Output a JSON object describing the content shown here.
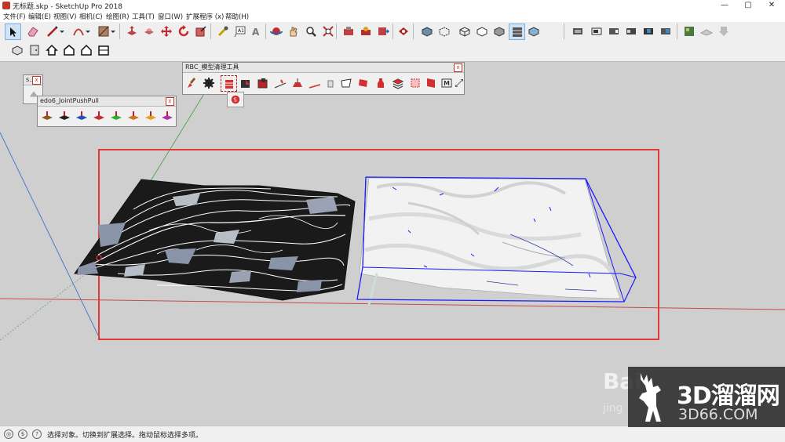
{
  "window": {
    "title": "无标题.skp - SketchUp Pro 2018",
    "minimize": "—",
    "maximize": "▢",
    "close": "✕"
  },
  "menu": [
    "文件(F)",
    "编辑(E)",
    "视图(V)",
    "相机(C)",
    "绘图(R)",
    "工具(T)",
    "窗口(W)",
    "扩展程序 (x)",
    "帮助(H)"
  ],
  "panels": {
    "small": {
      "title": "s...",
      "close": "x"
    },
    "joint": {
      "title": "edo6_JointPushPull",
      "close": "x"
    },
    "rbc": {
      "title": "RBC_模型清理工具",
      "close": "x"
    }
  },
  "status": {
    "text": "选择对象。切换到扩展选择。拖动鼠标选择多项。"
  },
  "watermark": {
    "main": "3D溜溜网",
    "sub": "3D66.COM",
    "baidu": "Bai",
    "baidu_sub": "jing"
  },
  "colors": {
    "selection_rect": "#e03a3a",
    "bbox": "#1a1aff",
    "axis_red": "#c94a4a",
    "axis_green": "#3aa03a",
    "axis_blue": "#4a7ac9"
  }
}
